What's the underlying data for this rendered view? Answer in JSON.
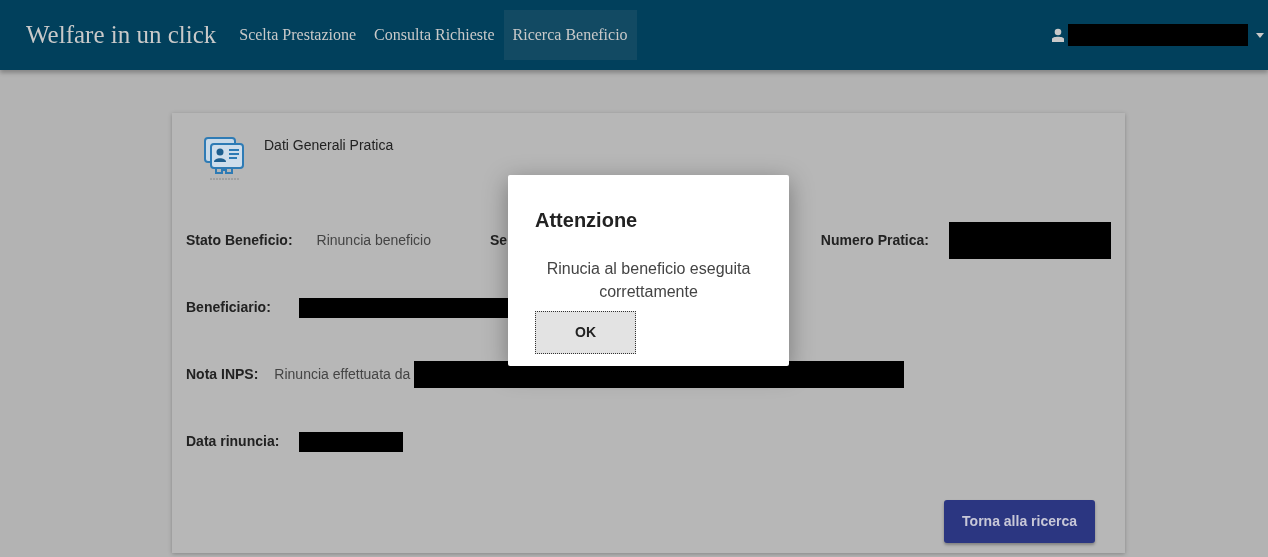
{
  "navbar": {
    "brand": "Welfare in un click",
    "links": [
      {
        "label": "Scelta Prestazione",
        "selected": false
      },
      {
        "label": "Consulta Richieste",
        "selected": false
      },
      {
        "label": "Ricerca Beneficio",
        "selected": true
      }
    ],
    "user": {
      "redacted": true
    }
  },
  "card": {
    "title": "Dati Generali Pratica",
    "rows": [
      [
        {
          "label": "Stato Beneficio:",
          "value": "Rinuncia beneficio"
        },
        {
          "label": "Se"
        },
        {
          "label": "Numero Pratica:",
          "redacted": true
        }
      ],
      [
        {
          "label": "Beneficiario:",
          "redacted": true
        }
      ],
      [
        {
          "label": "Nota INPS:",
          "value": "Rinuncia effettuata da",
          "redacted": true
        }
      ],
      [
        {
          "label": "Data rinuncia:",
          "redacted": true
        }
      ]
    ],
    "button": "Torna alla ricerca"
  },
  "modal": {
    "title": "Attenzione",
    "message": "Rinucia al beneficio eseguita correttamente",
    "button": "OK"
  }
}
